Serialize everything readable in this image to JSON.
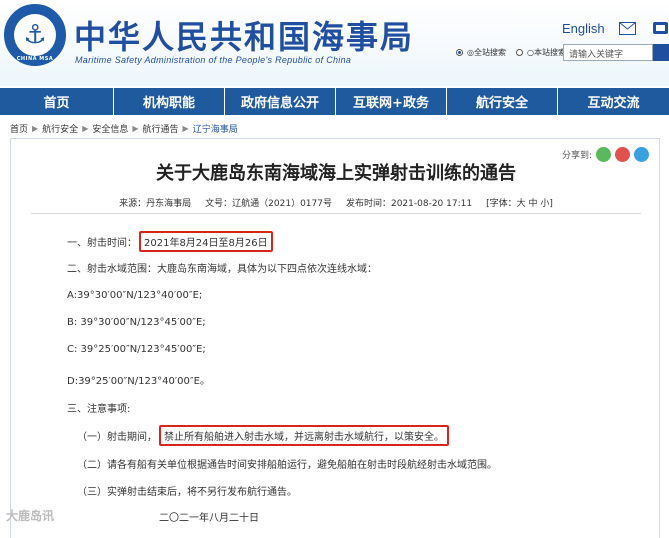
{
  "header": {
    "logo_text": "CHINA MSA",
    "site_title": "中华人民共和国海事局",
    "site_subtitle": "Maritime Safety Administration of the People's Republic of China",
    "lang_link": "English",
    "search_scope_1": "◎全站搜索",
    "search_scope_2": "○本站搜索",
    "search_placeholder": "请输入关键字"
  },
  "nav": {
    "items": [
      {
        "label": "首页"
      },
      {
        "label": "机构职能"
      },
      {
        "label": "政府信息公开"
      },
      {
        "label": "互联网+政务"
      },
      {
        "label": "航行安全"
      },
      {
        "label": "互动交流"
      }
    ]
  },
  "breadcrumb": {
    "items": [
      "首页",
      "航行安全",
      "安全信息",
      "航行通告",
      "辽宁海事局"
    ]
  },
  "article": {
    "share_label": "分享到:",
    "title": "关于大鹿岛东南海域海上实弹射击训练的通告",
    "source": "来源：丹东海事局",
    "doc_no": "文号：辽航通（2021）0177号",
    "publish_time": "发布时间：2021-08-20 17:11",
    "font_label": "[字体：大 中 小]",
    "p1_prefix": "一、射击时间：",
    "p1_highlight": "2021年8月24日至8月26日",
    "p2": "二、射击水域范围：大鹿岛东南海域，具体为以下四点依次连线水域：",
    "pA": "A:39°30′00″N/123°40′00″E;",
    "pB": "B: 39°30′00″N/123°45′00″E;",
    "pC": "C: 39°25′00″N/123°45′00″E;",
    "pD": "D:39°25′00″N/123°40′00″E。",
    "p3": "三、注意事项:",
    "n1_prefix": "（一）射击期间，",
    "n1_highlight": "禁止所有船舶进入射击水域，并远离射击水域航行，以策安全。",
    "n2": "（二）请各有船有关单位根据通告时间安排船舶运行，避免船舶在射击时段航经射击水域范围。",
    "n3": "（三）实弹射击结束后，将不另行发布航行通告。",
    "date": "二〇二一年八月二十日"
  },
  "watermark": "大鹿岛讯",
  "colors": {
    "nav_bg": "#1f5a9f",
    "title_blue": "#1f4f9e",
    "highlight_red": "#d9261c"
  }
}
